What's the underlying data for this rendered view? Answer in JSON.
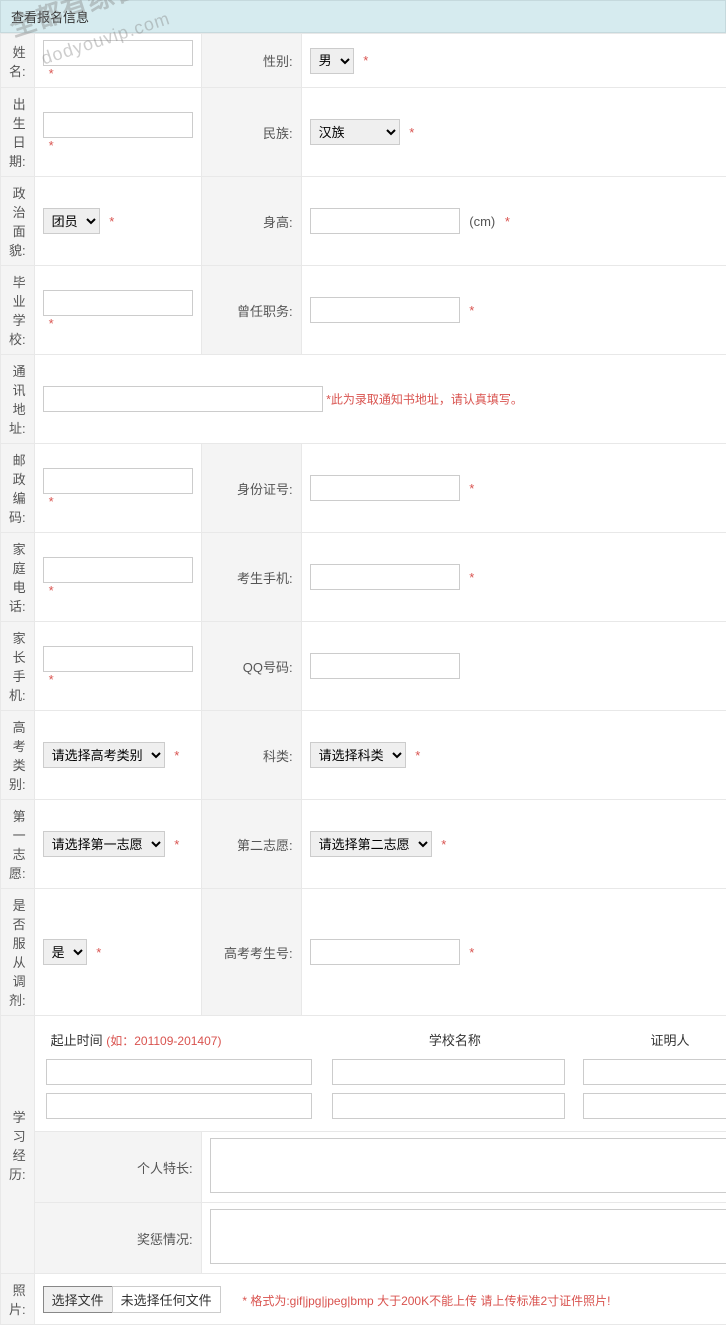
{
  "watermark": {
    "text": "全都有综合资源网",
    "url": "dodyouvip.com"
  },
  "panel": {
    "title": "查看报名信息"
  },
  "labels": {
    "name": "姓名:",
    "gender": "性别:",
    "birthdate": "出生日期:",
    "ethnicity": "民族:",
    "political": "政治面貌:",
    "height": "身高:",
    "graduate_school": "毕业学校:",
    "previous_position": "曾任职务:",
    "address": "通讯地址:",
    "postcode": "邮政编码:",
    "id_number": "身份证号:",
    "home_phone": "家庭电话:",
    "student_mobile": "考生手机:",
    "parent_mobile": "家长手机:",
    "qq": "QQ号码:",
    "exam_category": "高考类别:",
    "subject_category": "科类:",
    "first_choice": "第一志愿:",
    "second_choice": "第二志愿:",
    "accept_adjust": "是否服从调剂:",
    "exam_id": "高考考生号:",
    "education_history": "学习经历:",
    "personal_strength": "个人特长:",
    "awards": "奖惩情况:",
    "photo": "照片:"
  },
  "options": {
    "gender_selected": "男",
    "ethnicity_selected": "汉族",
    "political_selected": "团员",
    "exam_category_selected": "请选择高考类别",
    "subject_category_selected": "请选择科类",
    "first_choice_selected": "请选择第一志愿",
    "second_choice_selected": "请选择第二志愿",
    "accept_adjust_selected": "是"
  },
  "units": {
    "height_unit": "(cm)"
  },
  "hints": {
    "address_hint": "*此为录取通知书地址，请认真填写。",
    "history_header_time": "起止时间",
    "history_header_time_example": "(如：201109-201407)",
    "history_header_school": "学校名称",
    "history_header_witness": "证明人",
    "photo_format": "格式为:gif|jpg|jpeg|bmp",
    "photo_size": "大于200K不能上传 请上传标准2寸证件照片!"
  },
  "file": {
    "button": "选择文件",
    "no_file": "未选择任何文件"
  },
  "values": {
    "name": "",
    "birthdate": "",
    "height": "",
    "graduate_school": "",
    "previous_position": "",
    "address": "",
    "postcode": "",
    "id_number": "",
    "home_phone": "",
    "student_mobile": "",
    "parent_mobile": "",
    "qq": "",
    "exam_id": "",
    "personal_strength": "",
    "awards": ""
  }
}
